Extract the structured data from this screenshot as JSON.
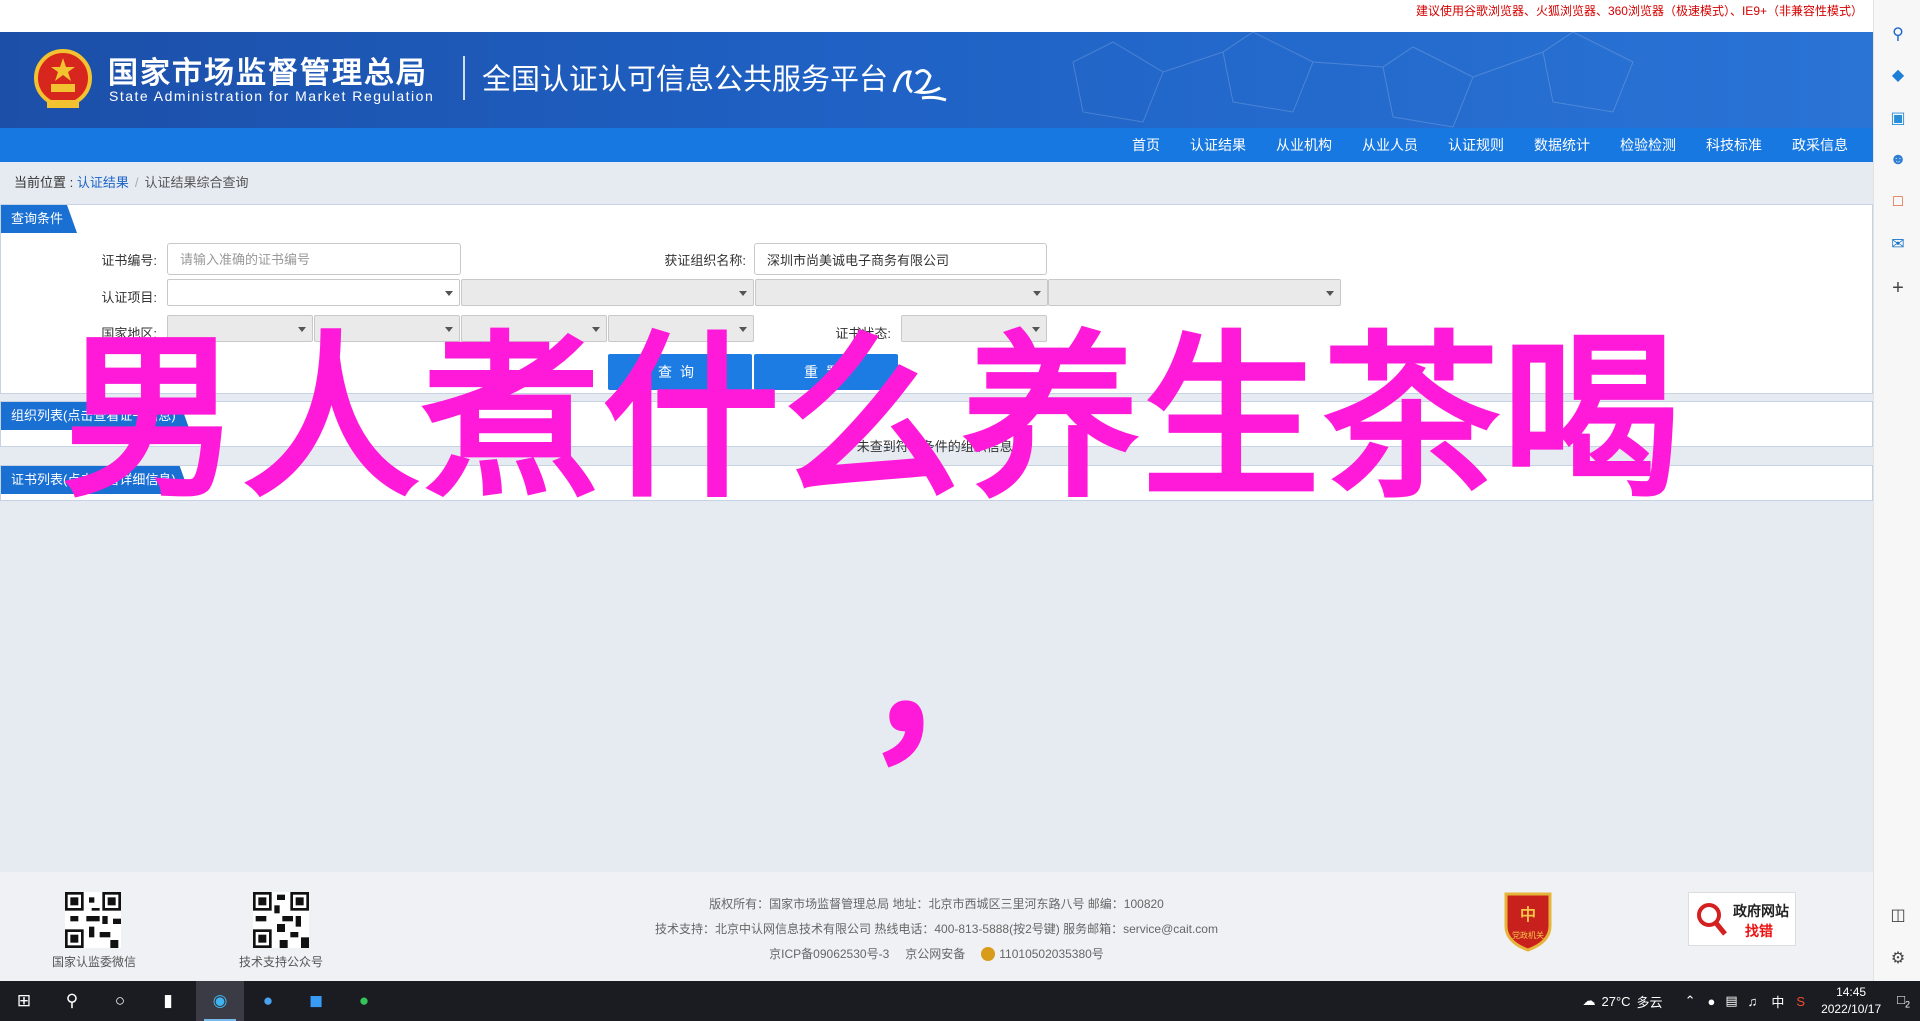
{
  "notice": "建议使用谷歌浏览器、火狐浏览器、360浏览器（极速模式）、IE9+（非兼容性模式）",
  "header": {
    "agency_cn": "国家市场监督管理总局",
    "agency_en": "State Administration  for  Market Regulation",
    "platform_title": "全国认证认可信息公共服务平台",
    "brand_color": "#1c4fa8"
  },
  "nav": {
    "items": [
      "首页",
      "认证结果",
      "从业机构",
      "从业人员",
      "认证规则",
      "数据统计",
      "检验检测",
      "科技标准",
      "政采信息"
    ]
  },
  "breadcrumb": {
    "prefix": "当前位置 : ",
    "link": "认证结果",
    "separator": "/",
    "current": "认证结果综合查询"
  },
  "query": {
    "tab": "查询条件",
    "cert_no_label": "证书编号:",
    "cert_no_placeholder": "请输入准确的证书编号",
    "org_name_label": "获证组织名称:",
    "org_name_value": "深圳市尚美诚电子商务有限公司",
    "project_label": "认证项目:",
    "region_label": "国家地区:",
    "status_label": "证书状态:",
    "search_button": "查询",
    "reset_button": "重置"
  },
  "org_list": {
    "tab": "组织列表(点击查看证书信息)",
    "empty_message": "未查到符合条件的组织信息!"
  },
  "cert_list": {
    "tab": "证书列表(点击查看详细信息)"
  },
  "overlay": {
    "text": "男人煮什么养生茶喝",
    "comma": "，",
    "color": "#ff1ad9"
  },
  "footer": {
    "qr_left_caption": "国家认监委微信",
    "qr_right_caption": "技术支持公众号",
    "line1": "版权所有：国家市场监督管理总局    地址：北京市西城区三里河东路八号    邮编：100820",
    "line2": "技术支持：北京中认网信息技术有限公司    热线电话：400-813-5888(按2号键)    服务邮箱：service@cait.com",
    "icp": "京ICP备09062530号-3",
    "police": "京公网安备",
    "police_no": "11010502035380号",
    "party_badge": "党政机关",
    "gov_badge_title": "政府网站",
    "gov_badge_action": "找错"
  },
  "rail_icons": [
    "search-icon",
    "tag-icon",
    "briefcase-icon",
    "people-icon",
    "office-icon",
    "outlook-icon",
    "plus-icon",
    "sidebar-toggle-icon",
    "gear-icon"
  ],
  "taskbar": {
    "weather_temp": "27°C",
    "weather_desc": "多云",
    "input_method": "中",
    "time": "14:45",
    "date": "2022/10/17",
    "notification_count": "2"
  }
}
